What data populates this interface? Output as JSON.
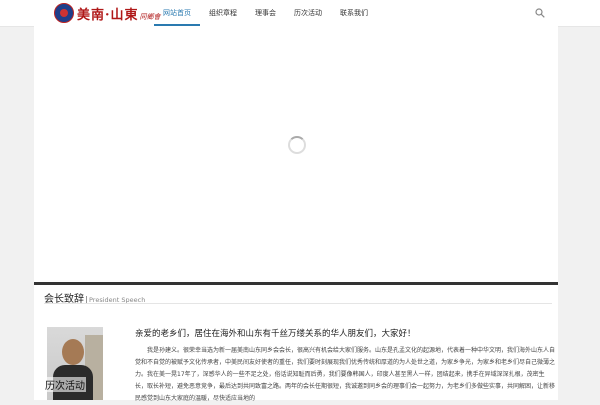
{
  "logo": {
    "text": "美南·山東",
    "sub": "同鄉會"
  },
  "nav": {
    "items": [
      {
        "label": "网站首页",
        "active": true
      },
      {
        "label": "组织章程",
        "active": false
      },
      {
        "label": "理事会",
        "active": false
      },
      {
        "label": "历次活动",
        "active": false
      },
      {
        "label": "联系我们",
        "active": false
      }
    ]
  },
  "search": {
    "icon": "search-icon"
  },
  "speech": {
    "title": "会长致辞",
    "subtitle": "President Speech",
    "greeting": "亲爱的老乡们，居住在海外和山东有千丝万缕关系的华人朋友们，大家好！",
    "paragraph": "我是孙建义。很荣幸当选为新一届美南山东同乡会会长，很高兴有机会给大家们服务。山东是孔孟文化的起源地，代表着一种中华文明，我们海外山东人自觉和不自觉的被赋予文化传承者，中美民间友好使者的重任，我们要时刻展现我们优秀传统和厚道的为人处世之道，为家乡争光，为家乡和老乡们尽自己微薄之力。我在美一晃17年了，深感华人的一些不足之处，俗话说知耻而后勇，我们要像韩国人，印度人甚至黑人一样，团结起来，携手在异域深深扎根，茂密生长，取长补短，避免恶意竞争，最后达到共同致富之路。两年的会长任期很短，我诚邀到同乡会的理事们会一起努力，为老乡们多做些实事，共同解困，让新移民感觉到山东大家庭的温暖，尽快适应当地的"
  },
  "overlay": {
    "label": "历次活动"
  }
}
